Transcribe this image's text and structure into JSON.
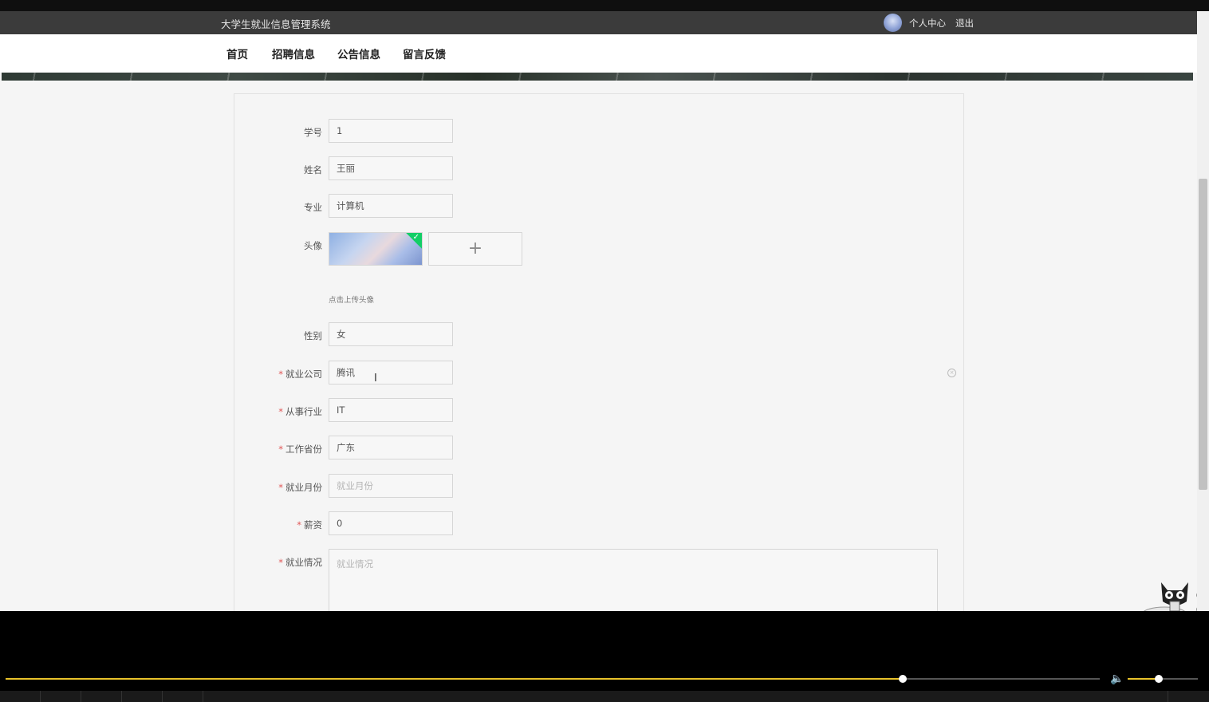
{
  "header": {
    "site_title": "大学生就业信息管理系统",
    "personal_center": "个人中心",
    "logout": "退出"
  },
  "nav": {
    "items": [
      "首页",
      "招聘信息",
      "公告信息",
      "留言反馈"
    ]
  },
  "form": {
    "student_id": {
      "label": "学号",
      "value": "1"
    },
    "name": {
      "label": "姓名",
      "value": "王丽"
    },
    "major": {
      "label": "专业",
      "value": "计算机"
    },
    "avatar": {
      "label": "头像",
      "upload_hint": "点击上传头像",
      "upload_plus": "+"
    },
    "gender": {
      "label": "性别",
      "value": "女"
    },
    "company": {
      "label": "就业公司",
      "value": "腾讯"
    },
    "industry": {
      "label": "从事行业",
      "value": "IT"
    },
    "province": {
      "label": "工作省份",
      "value": "广东"
    },
    "month": {
      "label": "就业月份",
      "placeholder": "就业月份"
    },
    "salary": {
      "label": "薪资",
      "value": "0"
    },
    "situation": {
      "label": "就业情况",
      "placeholder": "就业情况"
    },
    "required_mark": "*"
  },
  "player": {
    "progress": 0.82,
    "volume": 0.44
  }
}
